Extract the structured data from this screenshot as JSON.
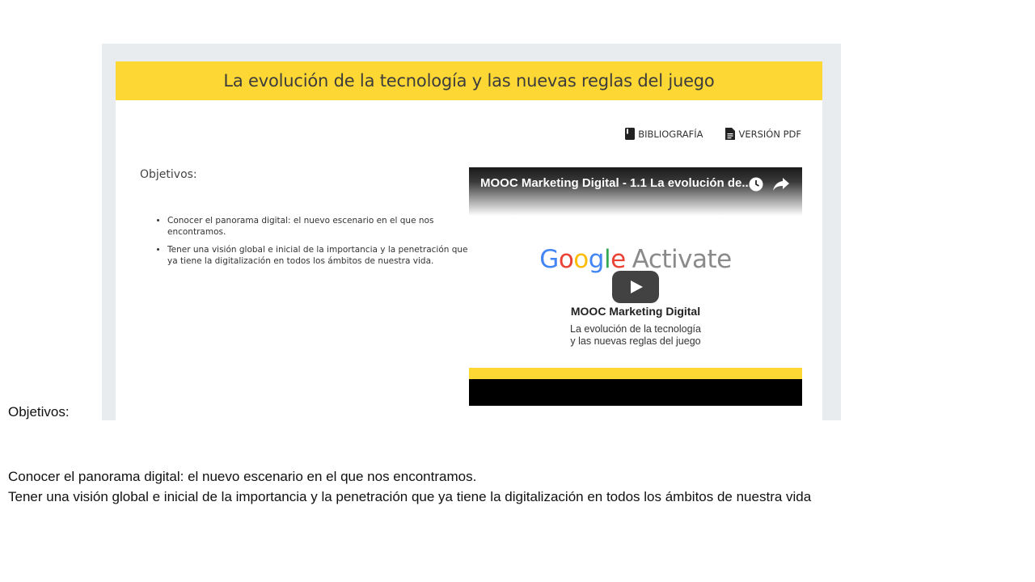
{
  "screenshot": {
    "title": "La evolución de la tecnología y las nuevas reglas del juego",
    "links": {
      "bibliography": "BIBLIOGRAFÍA",
      "pdf": "VERSIÓN PDF"
    },
    "objectives_heading": "Objetivos:",
    "objectives": [
      "Conocer el panorama digital: el nuevo escenario en el que nos encontramos.",
      "Tener una visión global e inicial de la importancia y la penetración que ya tiene la digitalización en todos los ámbitos de nuestra vida."
    ],
    "video": {
      "title": "MOOC Marketing Digital - 1.1 La evolución de...",
      "brand_letters": [
        "G",
        "o",
        "o",
        "g",
        "l",
        "e"
      ],
      "brand_suffix": "Activate",
      "main_title": "MOOC Marketing Digital",
      "subtitle_line1": "La evolución de la tecnología",
      "subtitle_line2": "y las nuevas reglas del juego"
    }
  },
  "slide": {
    "heading": "Objetivos:",
    "lines": [
      "Conocer el panorama digital: el nuevo escenario en el que nos encontramos.",
      "Tener una visión global e inicial de la importancia y la penetración que ya tiene la digitalización en todos los ámbitos de nuestra vida"
    ]
  },
  "colors": {
    "title_bar": "#fdd835",
    "google_blue": "#4285f4",
    "google_red": "#ea4335",
    "google_yellow": "#fbbc05",
    "google_green": "#34a853"
  }
}
